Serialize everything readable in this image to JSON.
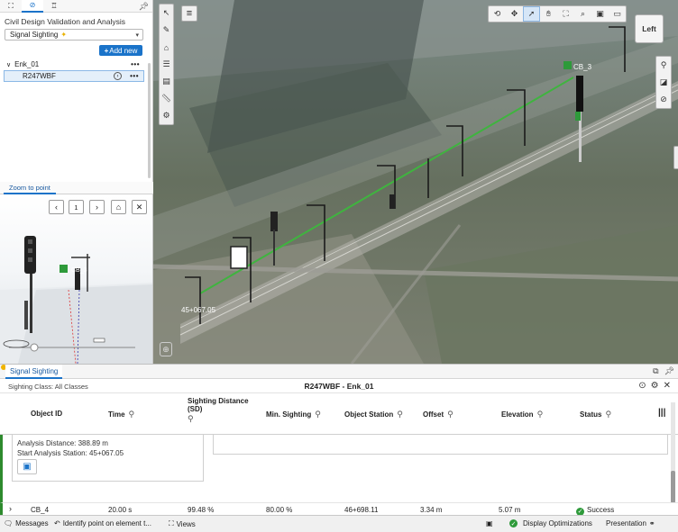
{
  "left_panel": {
    "title": "Civil Design Validation and Analysis",
    "analysis_select": "Signal Sighting",
    "add_new": "Add new",
    "tree": {
      "group": "Enk_01",
      "item": "R247WBF"
    }
  },
  "zoom_panel": {
    "tab": "Zoom to point",
    "page_number": "1",
    "markers": [
      "CB_3"
    ]
  },
  "viewport": {
    "view_cube": "Left",
    "labels": {
      "target_signal": "CB_3",
      "start_station": "45+067.05"
    },
    "sightline_color": "#3fb43f"
  },
  "bottom_panel": {
    "tab": "Signal Sighting",
    "sighting_class": "Sighting Class: All Classes",
    "title": "R247WBF - Enk_01",
    "columns": [
      "Object ID",
      "Time",
      "Sighting Distance (SD)",
      "Min. Sighting",
      "Object Station",
      "Offset",
      "Elevation",
      "Status"
    ],
    "details": {
      "analysis_distance": "Analysis Distance: 388.89 m",
      "start_station": "Start Analysis Station: 45+067.05"
    },
    "rows": [
      {
        "object_id": "CB_4",
        "time": "20.00 s",
        "sd": "99.48 %",
        "min": "80.00 %",
        "station": "46+698.11",
        "offset": "3.34 m",
        "elevation": "5.07 m",
        "status": "Success"
      }
    ]
  },
  "status_bar": {
    "messages": "Messages",
    "identify": "Identify point on element t...",
    "views": "Views",
    "display_opt": "Display Optimizations",
    "presentation": "Presentation"
  }
}
